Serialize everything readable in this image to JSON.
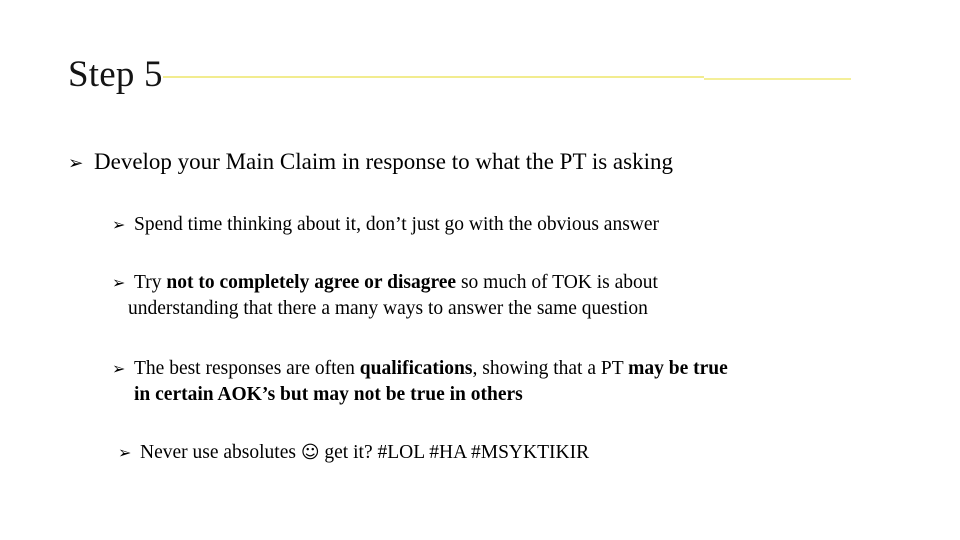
{
  "slide": {
    "title": "Step 5",
    "accent_color": "#f2ec8f",
    "text_color": "#000000",
    "background_color": "#ffffff",
    "bullet_marker": "➢",
    "smiley_glyph": "☺"
  },
  "content": {
    "main_bullet": {
      "text": "Develop your Main Claim in response to what the PT is asking"
    },
    "sub_bullets": [
      {
        "id": "sub-1",
        "line1_plain": "Spend time thinking about it, don’t just go with the obvious answer"
      },
      {
        "id": "sub-2",
        "line1_pre": "Try ",
        "line1_bold": "not to completely agree or disagree",
        "line1_post": " so much of TOK is about",
        "line2_plain": "understanding that there a many ways to answer the same question"
      },
      {
        "id": "sub-3",
        "line1_pre": "The  best responses are often ",
        "line1_bold1": "qualifications",
        "line1_mid": ", showing that a PT ",
        "line1_bold2": "may be true",
        "line2_bold": "in certain AOK’s but may not be true in others"
      },
      {
        "id": "sub-4",
        "line1_pre": "Never use absolutes ",
        "line1_smiley": "☺",
        "line1_post": " get it?  #LOL #HA #MSYKTIKIR"
      }
    ]
  }
}
